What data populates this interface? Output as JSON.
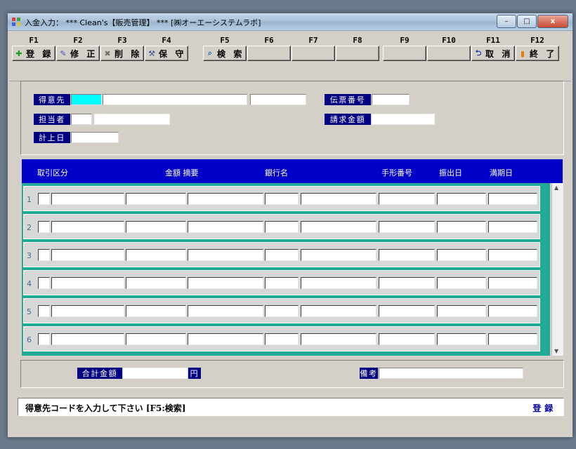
{
  "window": {
    "title": "入金入力： *** Clean's【販売管理】 *** [㈱オーエーシステムラボ]",
    "controls": {
      "minimize": "–",
      "maximize": "□",
      "close": "x"
    }
  },
  "fkeys": [
    {
      "key": "F1",
      "label": "登 録",
      "icon": "plus-icon",
      "glyph": "✚",
      "color": "#1a9a1a"
    },
    {
      "key": "F2",
      "label": "修 正",
      "icon": "pencil-icon",
      "glyph": "✎",
      "color": "#4050c0"
    },
    {
      "key": "F3",
      "label": "削 除",
      "icon": "trash-icon",
      "glyph": "✖",
      "color": "#707070"
    },
    {
      "key": "F4",
      "label": "保 守",
      "icon": "tools-icon",
      "glyph": "⚒",
      "color": "#305090"
    },
    {
      "key": "F5",
      "label": "検 索",
      "icon": "search-icon",
      "glyph": "⌕",
      "color": "#2070b0"
    },
    {
      "key": "F6",
      "label": ""
    },
    {
      "key": "F7",
      "label": ""
    },
    {
      "key": "F8",
      "label": ""
    },
    {
      "key": "F9",
      "label": ""
    },
    {
      "key": "F10",
      "label": ""
    },
    {
      "key": "F11",
      "label": "取 消",
      "icon": "undo-icon",
      "glyph": "⮌",
      "color": "#1040c0"
    },
    {
      "key": "F12",
      "label": "終 了",
      "icon": "exit-door-icon",
      "glyph": "▮",
      "color": "#e08010"
    }
  ],
  "header": {
    "customer_label": "得意先",
    "customer_code": "",
    "customer_name": "",
    "customer_sub": "",
    "staff_label": "担当者",
    "staff_code": "",
    "staff_name": "",
    "date_label": "計上日",
    "date_value": "",
    "slip_label": "伝票番号",
    "slip_value": "",
    "billing_label": "請求金額",
    "billing_value": ""
  },
  "grid": {
    "columns": {
      "type": "取引区分",
      "amount_memo": "金額 摘要",
      "bank": "銀行名",
      "bill_no": "手形番号",
      "issue_date": "振出日",
      "due_date": "満期日"
    },
    "rows": [
      "1",
      "2",
      "3",
      "4",
      "5",
      "6"
    ]
  },
  "footer": {
    "total_label": "合計金額",
    "total_value": "",
    "currency": "円",
    "note_label": "備考",
    "note_value": ""
  },
  "status": {
    "message": "得意先コードを入力して下さい [F5:検索]",
    "mode": "登録"
  },
  "colors": {
    "label_bg": "#000080",
    "grid_header_bg": "#0000c8",
    "grid_body_bg": "#22aa99",
    "customer_code_bg": "#00ffff"
  }
}
